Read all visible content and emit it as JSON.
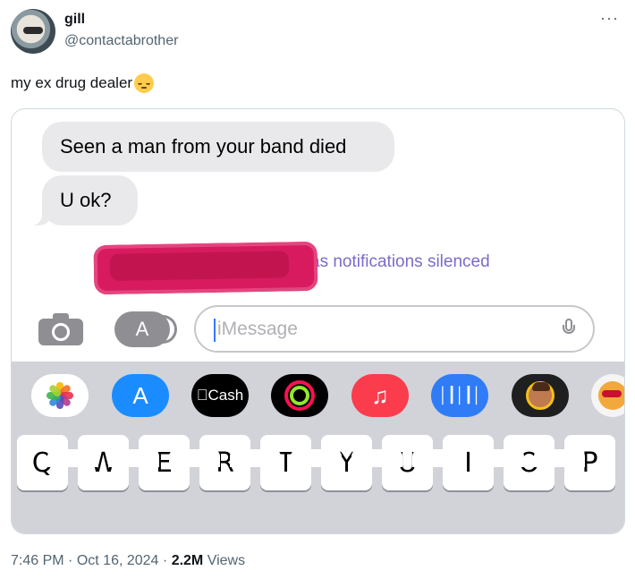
{
  "tweet": {
    "display_name": "gill",
    "handle": "@contactabrother",
    "text": "my ex drug dealer",
    "emoji": "relieved-face",
    "more_icon": "···"
  },
  "screenshot": {
    "messages": [
      {
        "text": "Seen a man from your band died",
        "side": "received"
      },
      {
        "text": "U ok?",
        "side": "received"
      }
    ],
    "silenced_notice": "has notifications silenced",
    "silenced_notice_visible": "as notifications silenced",
    "input": {
      "placeholder": "iMessage",
      "value": ""
    },
    "app_strip": [
      {
        "name": "Photos",
        "icon": "photos-icon"
      },
      {
        "name": "App Store",
        "icon": "app-store-icon",
        "glyph": "A"
      },
      {
        "name": "Cash",
        "icon": "apple-cash-icon",
        "label": "Cash"
      },
      {
        "name": "Fitness",
        "icon": "activity-rings-icon"
      },
      {
        "name": "Music",
        "icon": "music-icon",
        "glyph": "♫"
      },
      {
        "name": "Audio",
        "icon": "audio-message-icon",
        "glyph": "│┃│┃│"
      },
      {
        "name": "Memoji",
        "icon": "memoji-icon"
      },
      {
        "name": "Stickers",
        "icon": "sticker-icon"
      }
    ],
    "keyboard_row1": [
      "Q",
      "W",
      "E",
      "R",
      "T",
      "Y",
      "U",
      "I",
      "O",
      "P"
    ],
    "colors": {
      "bubble_gray": "#e9e9eb",
      "silenced_purple": "#7c6bc9",
      "redaction_pink": "#d81b5f",
      "keyboard_bg": "#d1d3d9"
    }
  },
  "footer": {
    "time": "7:46 PM",
    "separator": "·",
    "date": "Oct 16, 2024",
    "views_count": "2.2M",
    "views_label": "Views"
  }
}
